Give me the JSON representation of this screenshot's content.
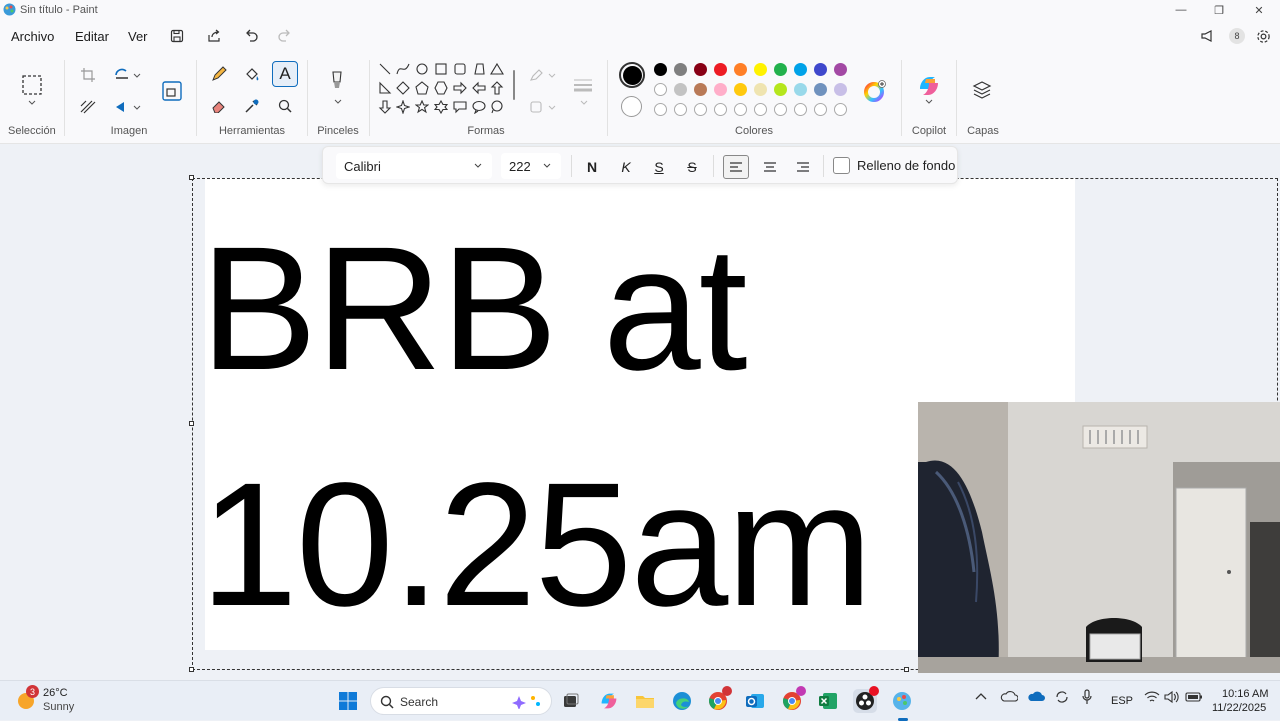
{
  "window": {
    "title": "Sin título - Paint"
  },
  "menu": {
    "items": [
      "Archivo",
      "Editar",
      "Ver"
    ]
  },
  "ribbon": {
    "groups": {
      "selection": "Selección",
      "image": "Imagen",
      "tools": "Herramientas",
      "brushes": "Pinceles",
      "shapes": "Formas",
      "colors": "Colores",
      "copilot": "Copilot",
      "layers": "Capas"
    },
    "palette_row1": [
      "#000000",
      "#7f7f7f",
      "#880015",
      "#ed1c24",
      "#ff7f27",
      "#fff200",
      "#22b14c",
      "#00a2e8",
      "#3f48cc",
      "#a349a4"
    ],
    "palette_row2": [
      "#ffffff",
      "#c3c3c3",
      "#b97a57",
      "#ffaec9",
      "#ffc90e",
      "#efe4b0",
      "#b5e61d",
      "#99d9ea",
      "#7092be",
      "#c8bfe7"
    ]
  },
  "text_toolbar": {
    "font": "Calibri",
    "size": "222",
    "bold": "N",
    "italic": "K",
    "underline": "S",
    "strike": "S",
    "background_fill_label": "Relleno de fondo"
  },
  "canvas": {
    "line1": "BRB at",
    "line2": "10.25am"
  },
  "taskbar": {
    "weather_temp": "26°C",
    "weather_desc": "Sunny",
    "weather_badge": "3",
    "search_placeholder": "Search",
    "language": "ESP",
    "time": "10:16 AM",
    "date": "11/22/2025",
    "notification_count": "8"
  },
  "colors": {
    "accent": "#0f6cbd",
    "text_selected": "#1c1c1c"
  }
}
